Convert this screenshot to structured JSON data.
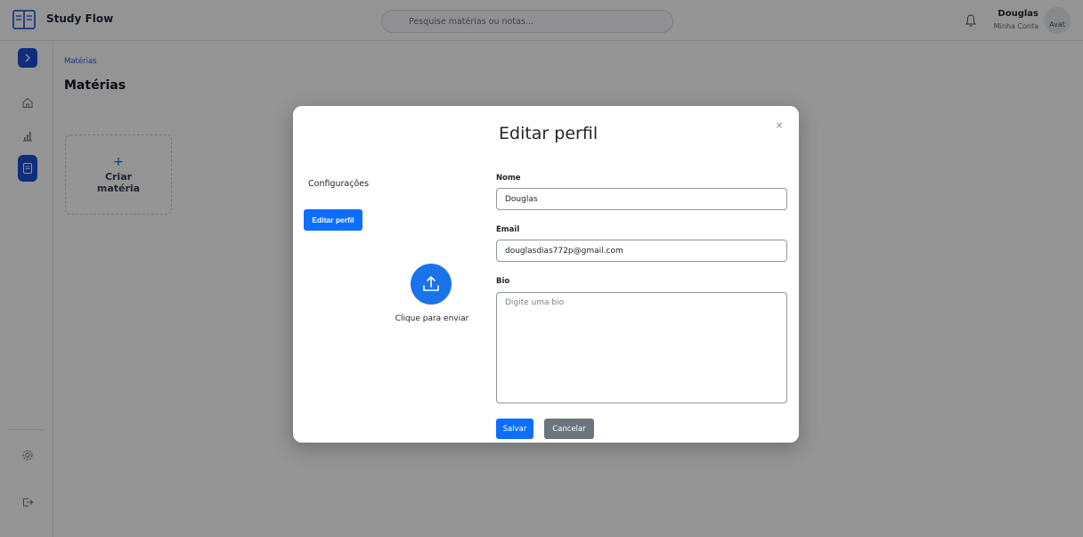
{
  "header": {
    "app_title": "Study Flow",
    "search_placeholder": "Pesquise matérias ou notas...",
    "user_name": "Douglas",
    "user_subtitle": "Minha Conta",
    "avatar_alt": "Avat"
  },
  "sidebar": {
    "items": [
      "chevron-right-icon",
      "home-icon",
      "chart-icon",
      "notes-icon",
      "gear-icon",
      "logout-icon"
    ]
  },
  "main": {
    "breadcrumb": "Matérias",
    "title": "Matérias",
    "create_card": {
      "plus": "+",
      "label": "Criar matéria"
    }
  },
  "modal": {
    "title": "Editar perfil",
    "close": "×",
    "menu": {
      "config": "Configurações",
      "edit_profile": "Editar perfil"
    },
    "upload_label": "Clique para enviar",
    "fields": {
      "name": {
        "label": "Nome",
        "value": "Douglas"
      },
      "email": {
        "label": "Email",
        "value": "douglasdias772p@gmail.com"
      },
      "bio": {
        "label": "Bio",
        "placeholder": "Digite uma bio"
      }
    },
    "buttons": {
      "save": "Salvar",
      "cancel": "Cancelar"
    }
  },
  "colors": {
    "primary": "#0d6efd",
    "secondary": "#6c757d",
    "sidebar_active": "#1d4ed8",
    "upload": "#1a73e8"
  }
}
